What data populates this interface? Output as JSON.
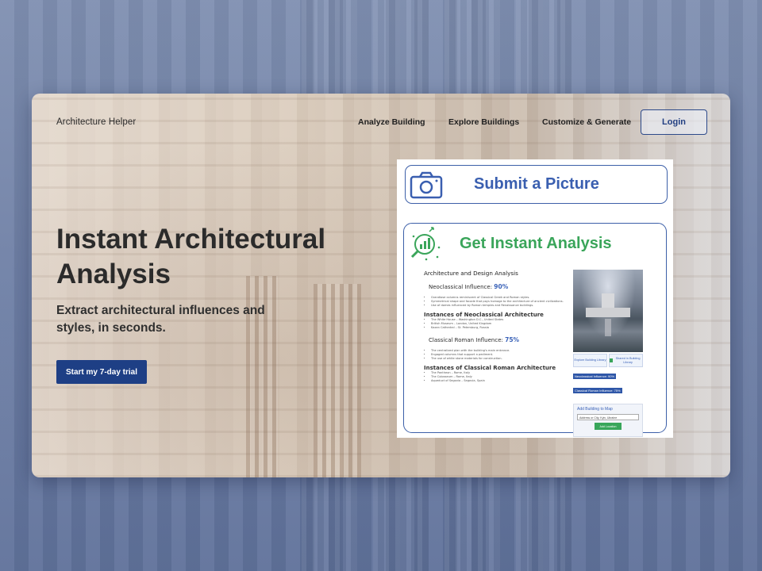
{
  "nav": {
    "brand": "Architecture Helper",
    "links": [
      "Analyze Building",
      "Explore Buildings",
      "Customize & Generate"
    ],
    "login": "Login"
  },
  "hero": {
    "title": "Instant Architectural Analysis",
    "subtitle": "Extract architectural influences and styles, in seconds.",
    "cta": "Start my 7-day trial"
  },
  "panel": {
    "submit_label": "Submit a Picture",
    "analysis_label": "Get Instant Analysis",
    "report": {
      "heading": "Architecture and Design Analysis",
      "neo_label": "Neoclassical Influence:",
      "neo_value": "90%",
      "neo_bullets": [
        "Grandiose columns reminiscent of Classical Greek and Roman styles.",
        "Symmetrical shape and facade that pays homage to the architecture of ancient civilizations.",
        "Use of domes influenced by Roman temples and Renaissance buildings."
      ],
      "neo_instances_heading": "Instances of Neoclassical Architecture",
      "neo_instances": [
        "The White House – Washington D.C., United States",
        "British Museum – London, United Kingdom",
        "Kazan Cathedral – St. Petersburg, Russia"
      ],
      "roman_label": "Classical Roman Influence:",
      "roman_value": "75%",
      "roman_bullets": [
        "The centralized plan with the building's main entrance.",
        "Engaged columns that support a pediment.",
        "The use of white stone materials for construction."
      ],
      "roman_instances_heading": "Instances of Classical Roman Architecture",
      "roman_instances": [
        "The Pantheon – Rome, Italy",
        "The Colosseum – Rome, Italy",
        "Aqueduct of Segovia – Segovia, Spain"
      ]
    },
    "side": {
      "explore_btn": "Explore Building Library",
      "shared_btn": "Shared in Building Library",
      "tag_neo": "Neoclassical Influence: 90%",
      "tag_roman": "Classical Roman Influence: 75%",
      "map_title": "Add Building to Map",
      "map_value": "Address or City, Kyiv, Ukraine",
      "map_button": "Add Location"
    }
  },
  "colors": {
    "brand_blue": "#1e3f85",
    "accent_blue": "#3a5fb0",
    "accent_green": "#3aa55a"
  }
}
